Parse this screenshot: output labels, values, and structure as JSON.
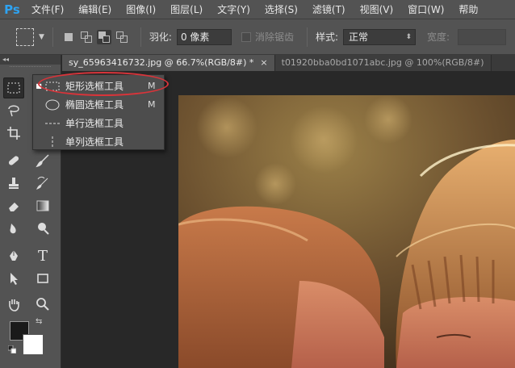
{
  "app": {
    "logo": "Ps"
  },
  "menu": [
    "文件(F)",
    "编辑(E)",
    "图像(I)",
    "图层(L)",
    "文字(Y)",
    "选择(S)",
    "滤镜(T)",
    "视图(V)",
    "窗口(W)",
    "帮助"
  ],
  "options": {
    "feather_label": "羽化:",
    "feather_value": "0 像素",
    "antialias_label": "消除锯齿",
    "style_label": "样式:",
    "style_value": "正常",
    "width_label": "宽度:"
  },
  "toolbox": {
    "collapse_label": "◂◂"
  },
  "flyout": {
    "items": [
      {
        "label": "矩形选框工具",
        "key": "M",
        "icon": "rect-marquee-icon"
      },
      {
        "label": "椭圆选框工具",
        "key": "M",
        "icon": "ellipse-marquee-icon"
      },
      {
        "label": "单行选框工具",
        "key": "",
        "icon": "single-row-marquee-icon"
      },
      {
        "label": "单列选框工具",
        "key": "",
        "icon": "single-column-marquee-icon"
      }
    ]
  },
  "tabs": [
    {
      "label": "sy_65963416732.jpg @ 66.7%(RGB/8#) *",
      "close": "×"
    },
    {
      "label": "t01920bba0bd1071abc.jpg @ 100%(RGB/8#)"
    }
  ],
  "colors": {
    "foreground": "#1a1a1a",
    "background": "#ffffff",
    "accent": "#2ea3f2",
    "highlight": "#d8343a"
  }
}
